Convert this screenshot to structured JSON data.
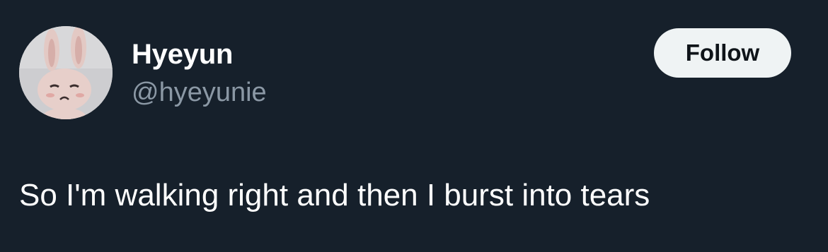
{
  "tweet": {
    "author": {
      "display_name": "Hyeyun",
      "handle": "@hyeyunie",
      "avatar_icon": "bunny-avatar"
    },
    "follow_label": "Follow",
    "text": "So I'm walking right and then I burst into tears"
  },
  "colors": {
    "background": "#16202b",
    "primary_text": "#ffffff",
    "secondary_text": "#8b98a5",
    "button_bg": "#eff3f4",
    "button_text": "#0f1419"
  }
}
